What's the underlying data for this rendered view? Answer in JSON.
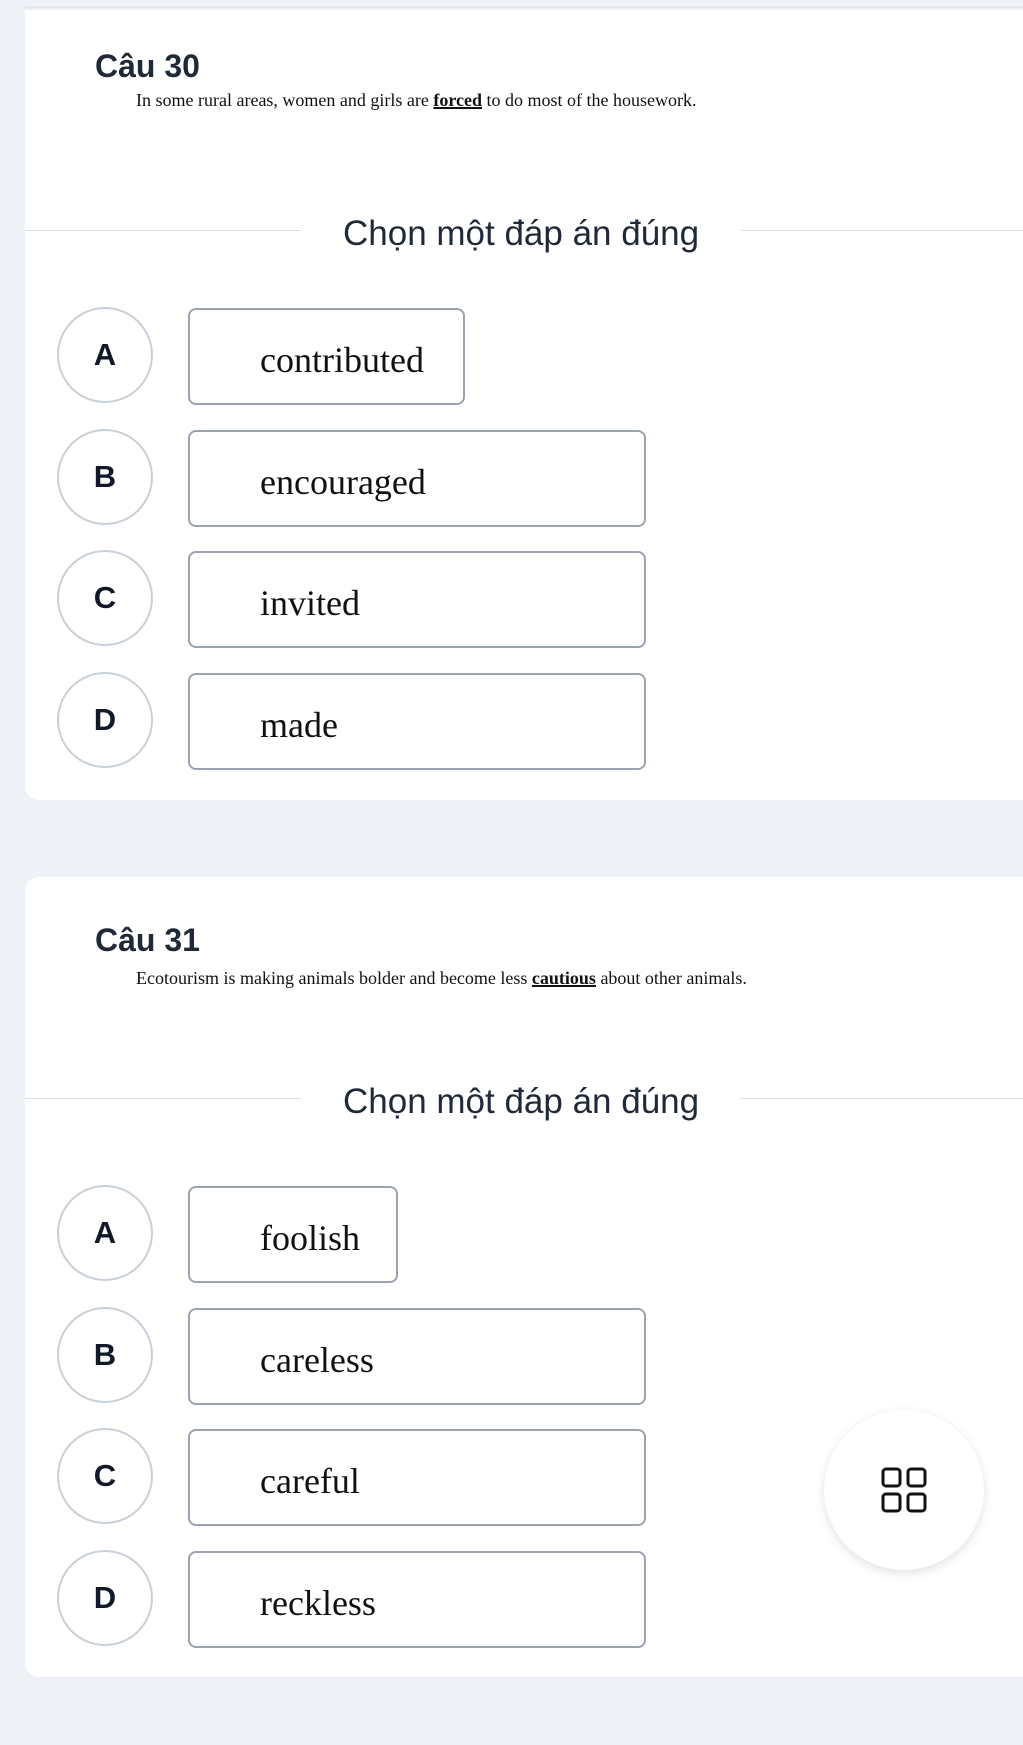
{
  "questions": [
    {
      "title": "Câu 30",
      "text_before": "In some rural areas, women and girls are ",
      "keyword": "forced",
      "text_after": " to do most of the housework.",
      "instruction": "Chọn một đáp án đúng",
      "options": [
        {
          "letter": "A",
          "text": "contributed"
        },
        {
          "letter": "B",
          "text": "encouraged"
        },
        {
          "letter": "C",
          "text": "invited"
        },
        {
          "letter": "D",
          "text": "made"
        }
      ]
    },
    {
      "title": "Câu 31",
      "text_before": "Ecotourism is making animals bolder and become less ",
      "keyword": "cautious",
      "text_after": " about other animals.",
      "instruction": "Chọn một đáp án đúng",
      "options": [
        {
          "letter": "A",
          "text": "foolish"
        },
        {
          "letter": "B",
          "text": "careless"
        },
        {
          "letter": "C",
          "text": "careful"
        },
        {
          "letter": "D",
          "text": "reckless"
        }
      ]
    }
  ],
  "fab": {
    "icon": "grid-icon"
  }
}
